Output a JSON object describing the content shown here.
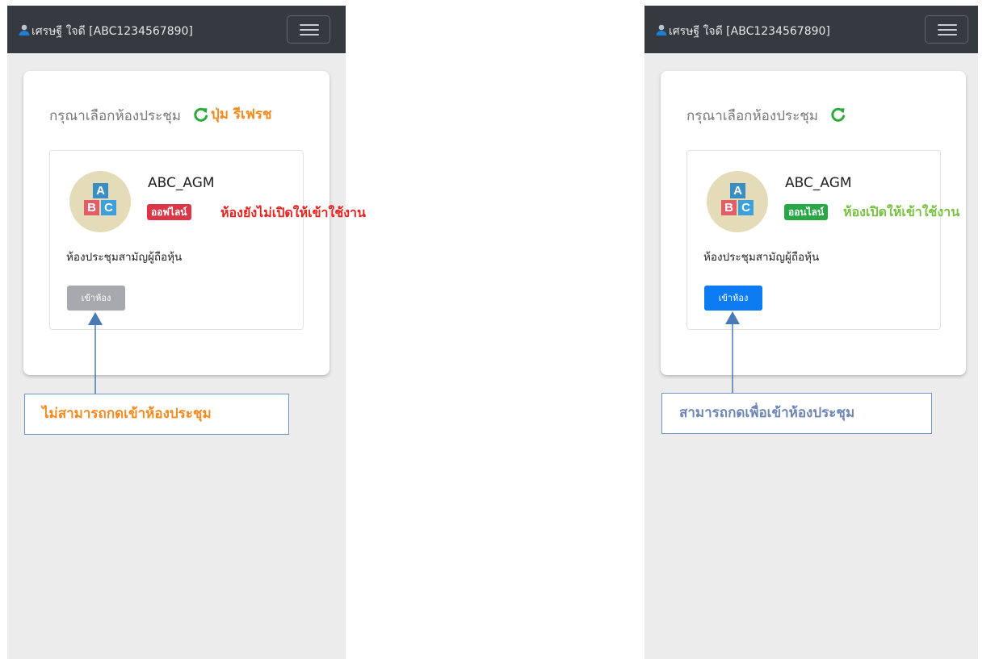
{
  "left_panel": {
    "header": {
      "user_name": "เศรษฐี ใจดี [ABC1234567890]"
    },
    "card": {
      "title": "กรุณาเลือกห้องประชุม",
      "refresh_label": "ปุ่ม รีเฟรช",
      "room": {
        "avatar_letters": [
          "A",
          "B",
          "C"
        ],
        "name": "ABC_AGM",
        "status": "ออฟไลน์",
        "description": "ห้องประชุมสามัญผู้ถือหุ้น",
        "enter_button": "เข้าห้อง"
      }
    },
    "annotation_status": "ห้องยังไม่เปิดให้เข้าใช้งาน",
    "callout": "ไม่สามารถกดเข้าห้องประชุม"
  },
  "right_panel": {
    "header": {
      "user_name": "เศรษฐี ใจดี [ABC1234567890]"
    },
    "card": {
      "title": "กรุณาเลือกห้องประชุม",
      "room": {
        "avatar_letters": [
          "A",
          "B",
          "C"
        ],
        "name": "ABC_AGM",
        "status": "ออนไลน์",
        "description": "ห้องประชุมสามัญผู้ถือหุ้น",
        "enter_button": "เข้าห้อง"
      }
    },
    "annotation_status": "ห้องเปิดให้เข้าใช้งาน",
    "callout": "สามารถกดเพื่อเข้าห้องประชุม"
  },
  "icons": {
    "user": "user-icon",
    "menu": "hamburger-menu-icon",
    "refresh": "refresh-icon",
    "avatar": "abc-blocks-icon"
  },
  "colors": {
    "topbar": "#343a40",
    "offline_badge": "#dc3545",
    "online_badge": "#28a745",
    "refresh_icon": "#2eaa3c",
    "disabled_button": "#a6a9ad",
    "enabled_button": "#0d7bf2",
    "offline_annotation": "#e52421",
    "online_annotation": "#7ac143",
    "left_callout_text": "#f58a1f",
    "right_callout_text": "#6f86b5",
    "callout_border": "#6f95c6"
  }
}
